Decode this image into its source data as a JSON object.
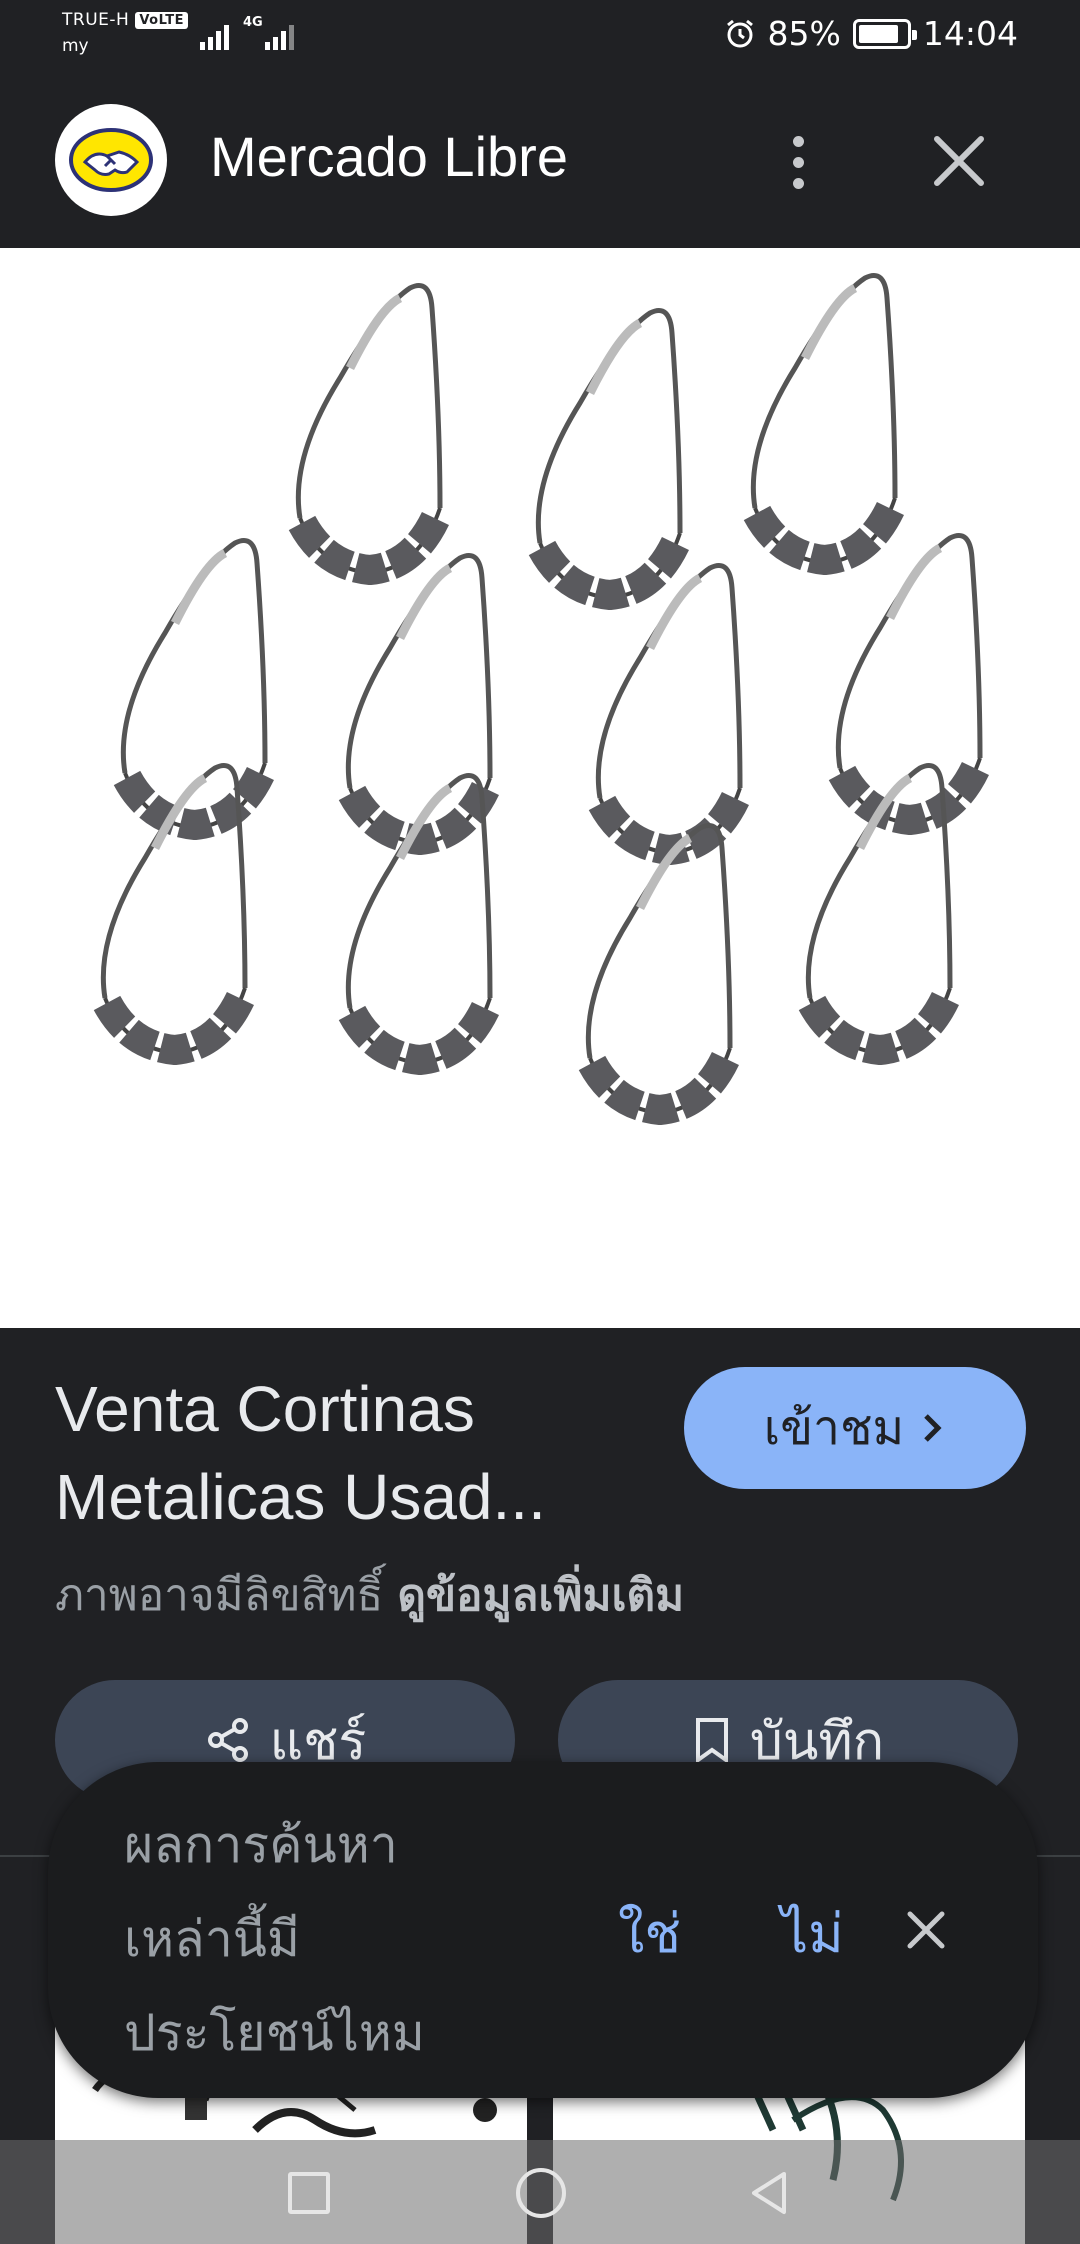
{
  "status_bar": {
    "carrier": "TRUE-H",
    "volte": "VoLTE",
    "carrier2": "my",
    "network": "4G",
    "battery": "85%",
    "battery_level": 0.85,
    "time": "14:04"
  },
  "app": {
    "title": "Mercado Libre",
    "logo_icon": "handshake-logo-icon"
  },
  "result": {
    "title": "Venta Cortinas Metalicas Usad...",
    "visit_label": "เข้าชม",
    "copyright_text": "ภาพอาจมีลิขสิทธิ์",
    "learn_more": "ดูข้อมูลเพิ่มเติม"
  },
  "actions": {
    "share_label": "แชร์",
    "save_label": "บันทึก"
  },
  "feedback": {
    "question": "ผลการค้นหาเหล่านี้มีประโยชน์ไหม",
    "yes": "ใช่",
    "no": "ไม่"
  },
  "colors": {
    "accent": "#8ab4f8",
    "background": "#202124",
    "button": "#3c4555"
  }
}
